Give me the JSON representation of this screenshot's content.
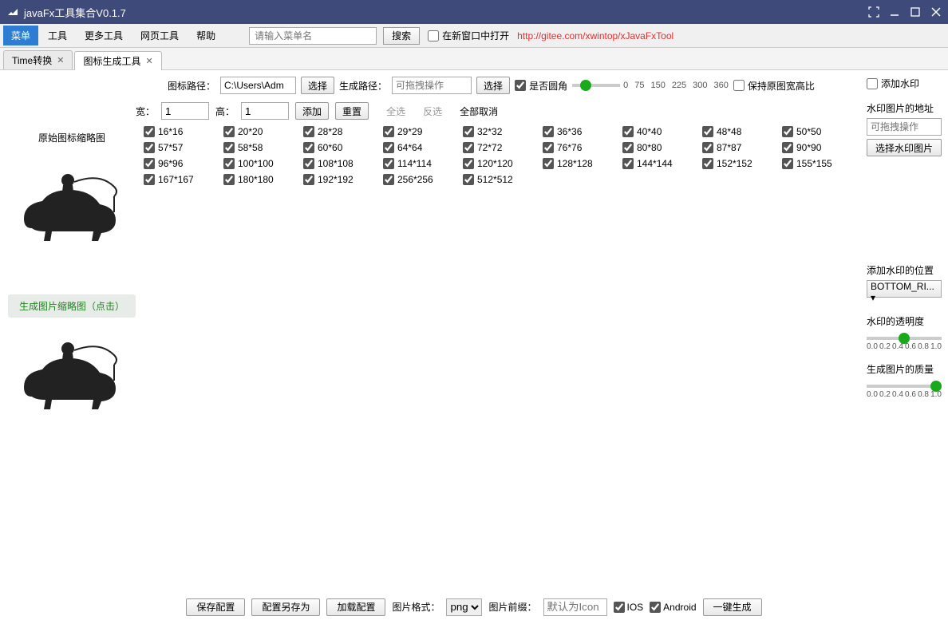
{
  "title": "javaFx工具集合V0.1.7",
  "menubar": {
    "items": [
      "菜单",
      "工具",
      "更多工具",
      "网页工具",
      "帮助"
    ],
    "search_placeholder": "请输入菜单名",
    "search_btn": "搜索",
    "new_window": "在新窗口中打开",
    "url": "http://gitee.com/xwintop/xJavaFxTool"
  },
  "tabs": [
    {
      "label": "Time转换"
    },
    {
      "label": "图标生成工具"
    }
  ],
  "path_row": {
    "icon_path_label": "图标路径：",
    "icon_path_value": "C:\\Users\\Adm",
    "choose": "选择",
    "gen_path_label": "生成路径：",
    "gen_path_placeholder": "可拖拽操作",
    "round_label": "是否圆角",
    "round_ticks": [
      "0",
      "75",
      "150",
      "225",
      "300",
      "360"
    ],
    "keep_ratio_label": "保持原图宽高比"
  },
  "dim_row": {
    "width_label": "宽：",
    "width_value": "1",
    "height_label": "高：",
    "height_value": "1",
    "add_btn": "添加",
    "reset_btn": "重置",
    "select_all": "全选",
    "invert": "反选",
    "deselect_all": "全部取消"
  },
  "thumbs": {
    "src_label": "原始图标缩略图",
    "gen_label": "生成图片缩略图（点击）"
  },
  "sizes": [
    [
      "16*16",
      "20*20",
      "28*28",
      "29*29",
      "32*32",
      "36*36",
      "40*40",
      "48*48",
      "50*50"
    ],
    [
      "57*57",
      "58*58",
      "60*60",
      "64*64",
      "72*72",
      "76*76",
      "80*80",
      "87*87",
      "90*90"
    ],
    [
      "96*96",
      "100*100",
      "108*108",
      "114*114",
      "120*120",
      "128*128",
      "144*144",
      "152*152",
      "155*155"
    ],
    [
      "167*167",
      "180*180",
      "192*192",
      "256*256",
      "512*512"
    ]
  ],
  "side": {
    "add_watermark": "添加水印",
    "watermark_addr_label": "水印图片的地址",
    "watermark_addr_placeholder": "可拖拽操作",
    "choose_watermark_btn": "选择水印图片",
    "watermark_pos_label": "添加水印的位置",
    "watermark_pos_value": "BOTTOM_RI...",
    "opacity_label": "水印的透明度",
    "quality_label": "生成图片的质量",
    "slider_ticks": [
      "0.0",
      "0.2",
      "0.4",
      "0.6",
      "0.8",
      "1.0"
    ]
  },
  "footer": {
    "save_cfg": "保存配置",
    "save_as": "配置另存为",
    "load_cfg": "加载配置",
    "format_label": "图片格式：",
    "format_value": "png",
    "prefix_label": "图片前缀：",
    "prefix_placeholder": "默认为Icon",
    "ios": "IOS",
    "android": "Android",
    "generate": "一键生成"
  }
}
